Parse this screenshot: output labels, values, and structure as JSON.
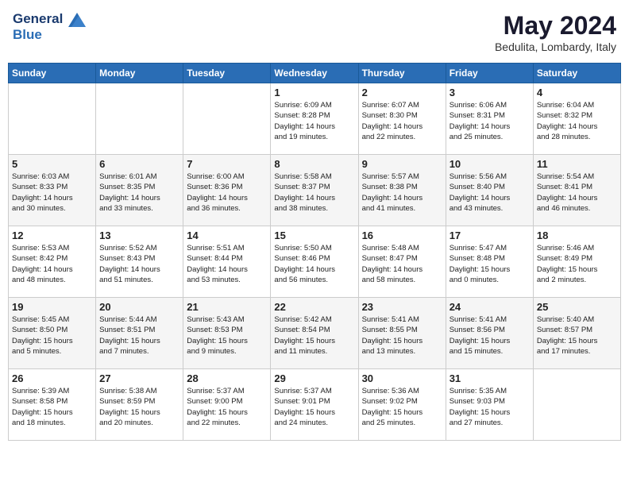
{
  "header": {
    "logo_line1": "General",
    "logo_line2": "Blue",
    "month_title": "May 2024",
    "location": "Bedulita, Lombardy, Italy"
  },
  "days_of_week": [
    "Sunday",
    "Monday",
    "Tuesday",
    "Wednesday",
    "Thursday",
    "Friday",
    "Saturday"
  ],
  "weeks": [
    [
      {
        "day": "",
        "info": ""
      },
      {
        "day": "",
        "info": ""
      },
      {
        "day": "",
        "info": ""
      },
      {
        "day": "1",
        "info": "Sunrise: 6:09 AM\nSunset: 8:28 PM\nDaylight: 14 hours\nand 19 minutes."
      },
      {
        "day": "2",
        "info": "Sunrise: 6:07 AM\nSunset: 8:30 PM\nDaylight: 14 hours\nand 22 minutes."
      },
      {
        "day": "3",
        "info": "Sunrise: 6:06 AM\nSunset: 8:31 PM\nDaylight: 14 hours\nand 25 minutes."
      },
      {
        "day": "4",
        "info": "Sunrise: 6:04 AM\nSunset: 8:32 PM\nDaylight: 14 hours\nand 28 minutes."
      }
    ],
    [
      {
        "day": "5",
        "info": "Sunrise: 6:03 AM\nSunset: 8:33 PM\nDaylight: 14 hours\nand 30 minutes."
      },
      {
        "day": "6",
        "info": "Sunrise: 6:01 AM\nSunset: 8:35 PM\nDaylight: 14 hours\nand 33 minutes."
      },
      {
        "day": "7",
        "info": "Sunrise: 6:00 AM\nSunset: 8:36 PM\nDaylight: 14 hours\nand 36 minutes."
      },
      {
        "day": "8",
        "info": "Sunrise: 5:58 AM\nSunset: 8:37 PM\nDaylight: 14 hours\nand 38 minutes."
      },
      {
        "day": "9",
        "info": "Sunrise: 5:57 AM\nSunset: 8:38 PM\nDaylight: 14 hours\nand 41 minutes."
      },
      {
        "day": "10",
        "info": "Sunrise: 5:56 AM\nSunset: 8:40 PM\nDaylight: 14 hours\nand 43 minutes."
      },
      {
        "day": "11",
        "info": "Sunrise: 5:54 AM\nSunset: 8:41 PM\nDaylight: 14 hours\nand 46 minutes."
      }
    ],
    [
      {
        "day": "12",
        "info": "Sunrise: 5:53 AM\nSunset: 8:42 PM\nDaylight: 14 hours\nand 48 minutes."
      },
      {
        "day": "13",
        "info": "Sunrise: 5:52 AM\nSunset: 8:43 PM\nDaylight: 14 hours\nand 51 minutes."
      },
      {
        "day": "14",
        "info": "Sunrise: 5:51 AM\nSunset: 8:44 PM\nDaylight: 14 hours\nand 53 minutes."
      },
      {
        "day": "15",
        "info": "Sunrise: 5:50 AM\nSunset: 8:46 PM\nDaylight: 14 hours\nand 56 minutes."
      },
      {
        "day": "16",
        "info": "Sunrise: 5:48 AM\nSunset: 8:47 PM\nDaylight: 14 hours\nand 58 minutes."
      },
      {
        "day": "17",
        "info": "Sunrise: 5:47 AM\nSunset: 8:48 PM\nDaylight: 15 hours\nand 0 minutes."
      },
      {
        "day": "18",
        "info": "Sunrise: 5:46 AM\nSunset: 8:49 PM\nDaylight: 15 hours\nand 2 minutes."
      }
    ],
    [
      {
        "day": "19",
        "info": "Sunrise: 5:45 AM\nSunset: 8:50 PM\nDaylight: 15 hours\nand 5 minutes."
      },
      {
        "day": "20",
        "info": "Sunrise: 5:44 AM\nSunset: 8:51 PM\nDaylight: 15 hours\nand 7 minutes."
      },
      {
        "day": "21",
        "info": "Sunrise: 5:43 AM\nSunset: 8:53 PM\nDaylight: 15 hours\nand 9 minutes."
      },
      {
        "day": "22",
        "info": "Sunrise: 5:42 AM\nSunset: 8:54 PM\nDaylight: 15 hours\nand 11 minutes."
      },
      {
        "day": "23",
        "info": "Sunrise: 5:41 AM\nSunset: 8:55 PM\nDaylight: 15 hours\nand 13 minutes."
      },
      {
        "day": "24",
        "info": "Sunrise: 5:41 AM\nSunset: 8:56 PM\nDaylight: 15 hours\nand 15 minutes."
      },
      {
        "day": "25",
        "info": "Sunrise: 5:40 AM\nSunset: 8:57 PM\nDaylight: 15 hours\nand 17 minutes."
      }
    ],
    [
      {
        "day": "26",
        "info": "Sunrise: 5:39 AM\nSunset: 8:58 PM\nDaylight: 15 hours\nand 18 minutes."
      },
      {
        "day": "27",
        "info": "Sunrise: 5:38 AM\nSunset: 8:59 PM\nDaylight: 15 hours\nand 20 minutes."
      },
      {
        "day": "28",
        "info": "Sunrise: 5:37 AM\nSunset: 9:00 PM\nDaylight: 15 hours\nand 22 minutes."
      },
      {
        "day": "29",
        "info": "Sunrise: 5:37 AM\nSunset: 9:01 PM\nDaylight: 15 hours\nand 24 minutes."
      },
      {
        "day": "30",
        "info": "Sunrise: 5:36 AM\nSunset: 9:02 PM\nDaylight: 15 hours\nand 25 minutes."
      },
      {
        "day": "31",
        "info": "Sunrise: 5:35 AM\nSunset: 9:03 PM\nDaylight: 15 hours\nand 27 minutes."
      },
      {
        "day": "",
        "info": ""
      }
    ]
  ]
}
